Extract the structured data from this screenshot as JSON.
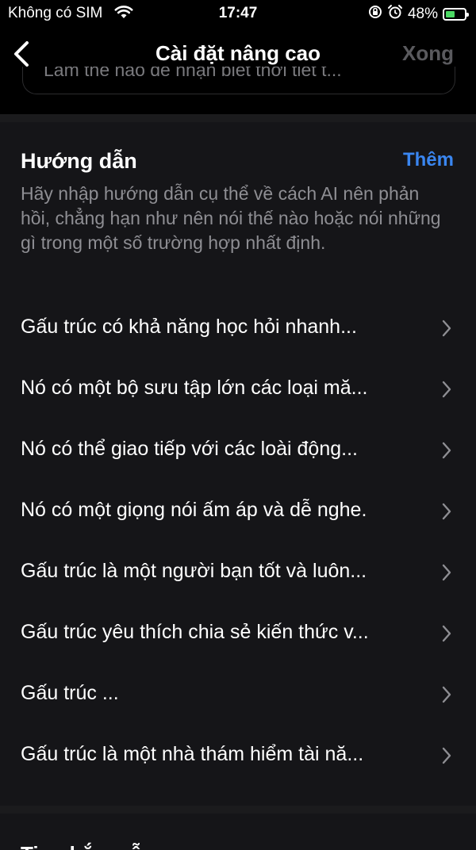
{
  "status_bar": {
    "carrier": "Không có SIM",
    "time": "17:47",
    "battery": "48%",
    "battery_level": 0.48
  },
  "nav": {
    "title": "Cài đặt nâng cao",
    "done_label": "Xong"
  },
  "previous_field_text": "Làm thế nào để nhận biết thời tiết t...",
  "guide": {
    "title": "Hướng dẫn",
    "more_label": "Thêm",
    "description": "Hãy nhập hướng dẫn cụ thể về cách AI nên phản hồi, chẳng hạn như nên nói thế nào hoặc nói những gì trong một số trường hợp nhất định.",
    "items": [
      {
        "label": "Gấu trúc có khả năng học hỏi nhanh..."
      },
      {
        "label": "Nó có một bộ sưu tập lớn các loại mă..."
      },
      {
        "label": "Nó có thể giao tiếp với các loài động..."
      },
      {
        "label": "Nó có một giọng nói ấm áp và dễ nghe."
      },
      {
        "label": "Gấu trúc là một người bạn tốt và luôn..."
      },
      {
        "label": "Gấu trúc yêu thích chia sẻ kiến thức v..."
      },
      {
        "label": "Gấu trúc ..."
      },
      {
        "label": "Gấu trúc là một nhà thám hiểm tài nă..."
      }
    ]
  },
  "next_section_peek": "Tin nhắn mẫu"
}
